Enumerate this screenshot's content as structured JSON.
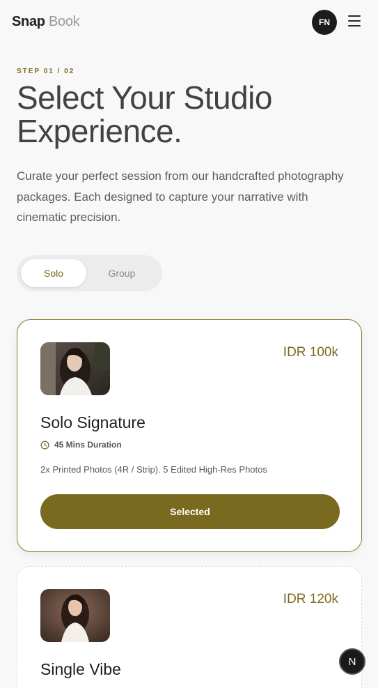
{
  "header": {
    "logo_part1": "Snap",
    "logo_part2": "Book",
    "avatar_initials": "FN",
    "menu_icon": "hamburger-menu-icon"
  },
  "intro": {
    "step": "STEP 01 / 02",
    "title": "Select Your Studio Experience.",
    "description": "Curate your perfect session from our handcrafted photography packages. Each designed to capture your narrative with cinematic precision."
  },
  "toggle": {
    "options": [
      "Solo",
      "Group"
    ],
    "selected": "Solo"
  },
  "packages": [
    {
      "name": "Solo Signature",
      "price": "IDR 100k",
      "duration": "45 Mins Duration",
      "features": "2x Printed Photos (4R / Strip). 5 Edited High-Res Photos",
      "button_label": "Selected"
    },
    {
      "name": "Single Vibe",
      "price": "IDR 120k"
    }
  ],
  "fab_label": "N",
  "colors": {
    "accent": "#7a6a1f",
    "background": "#f8f8f8",
    "avatar_bg": "#1c1c1c"
  }
}
